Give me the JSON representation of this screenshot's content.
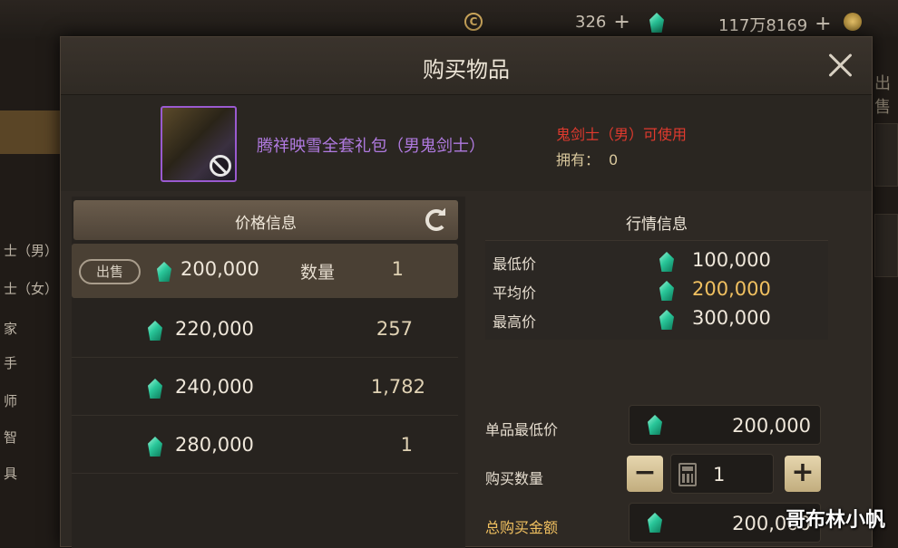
{
  "topbar": {
    "currency_c_value": "326",
    "currency_gem_value": "117万8169",
    "icon_c": "C",
    "plus": "+"
  },
  "left_bg": {
    "rows": [
      "士（男）",
      "士（女）",
      "家",
      "手",
      "师",
      "智",
      "具"
    ]
  },
  "right_bg": {
    "text": "出售"
  },
  "modal": {
    "title": "购买物品",
    "item": {
      "name": "腾祥映雪全套礼包（男鬼剑士）",
      "class_req": "鬼剑士（男）可使用",
      "owned_label": "拥有：",
      "owned_value": "0"
    },
    "price_info": {
      "title": "价格信息",
      "sell_tag": "出售",
      "qty_label": "数量",
      "offers": [
        {
          "price": "200,000",
          "qty": "1"
        },
        {
          "price": "220,000",
          "qty": "257"
        },
        {
          "price": "240,000",
          "qty": "1,782"
        },
        {
          "price": "280,000",
          "qty": "1"
        }
      ]
    },
    "market": {
      "title": "行情信息",
      "rows": [
        {
          "label": "最低价",
          "value": "100,000"
        },
        {
          "label": "平均价",
          "value": "200,000"
        },
        {
          "label": "最高价",
          "value": "300,000"
        }
      ]
    },
    "form": {
      "unit_min_label": "单品最低价",
      "unit_min_value": "200,000",
      "quantity_label": "购买数量",
      "quantity_value": "1",
      "minus": "−",
      "plus": "+",
      "total_label": "总购买金额",
      "total_value": "200,000"
    }
  },
  "watermark": "哥布林小帆",
  "colors": {
    "accent_gold": "#f0c060",
    "item_purple": "#b07ae0",
    "warning_red": "#e03a2e",
    "gem_green": "#29c79a"
  }
}
